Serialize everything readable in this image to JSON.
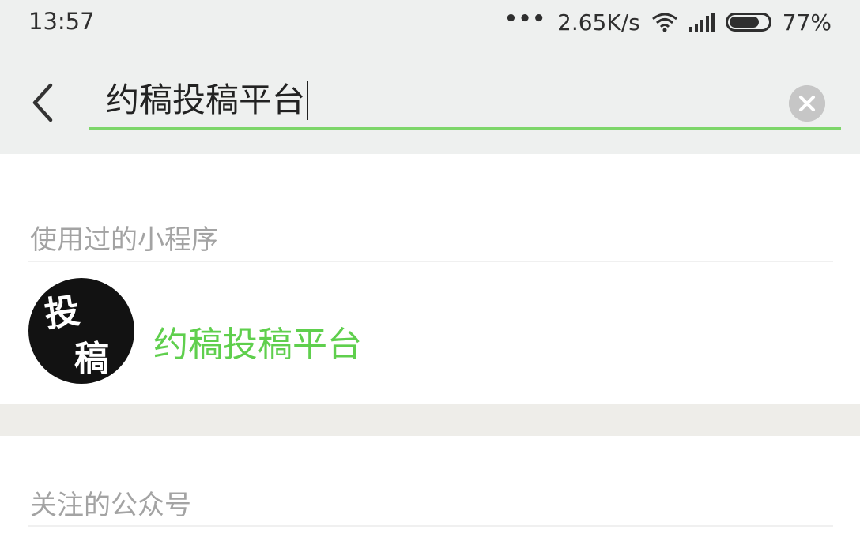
{
  "status_bar": {
    "time": "13:57",
    "dots": "•••",
    "net_speed": "2.65K/s",
    "battery": "77%",
    "battery_level": 0.77
  },
  "search": {
    "query": "约稿投稿平台"
  },
  "sections": {
    "mini_programs_title": "使用过的小程序",
    "mini_program_result": {
      "name": "约稿投稿平台",
      "avatar_chars": [
        "投",
        "稿"
      ]
    },
    "official_accounts_title": "关注的公众号"
  },
  "colors": {
    "accent": "#5fcf4d",
    "underline": "#7dd66a",
    "header_bg": "#eef0ef",
    "label": "#a3a3a3"
  },
  "icons": [
    "back-arrow-icon",
    "clear-icon",
    "wifi-icon",
    "signal-icon",
    "battery-icon"
  ]
}
